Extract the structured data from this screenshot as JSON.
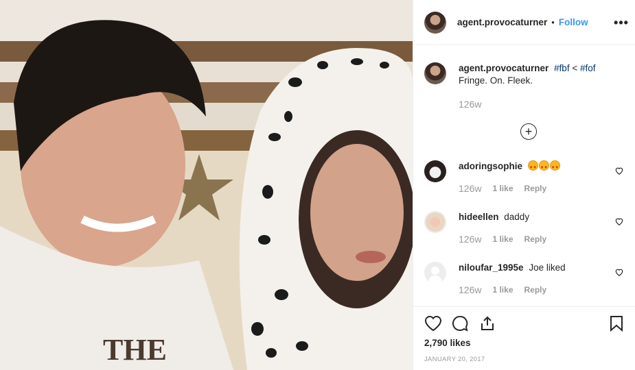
{
  "post": {
    "author": "agent.provocaturner",
    "follow_label": "Follow",
    "more_label": "•••",
    "caption": {
      "username": "agent.provocaturner",
      "hashtag1": "#fbf",
      "separator": "<",
      "hashtag2": "#fof",
      "text": "Fringe. On. Fleek.",
      "time": "126w"
    },
    "load_more_label": "+",
    "comments": [
      {
        "username": "adoringsophie",
        "text": "",
        "emoji": "heart-eyes x3",
        "time": "126w",
        "likes": "1 like",
        "reply": "Reply"
      },
      {
        "username": "hideellen",
        "text": "daddy",
        "time": "126w",
        "likes": "1 like",
        "reply": "Reply"
      },
      {
        "username": "niloufar_1995e",
        "text": "Joe liked",
        "time": "126w",
        "likes": "1 like",
        "reply": "Reply"
      }
    ],
    "like_count": "2,790 likes",
    "date": "JANUARY 20, 2017"
  },
  "colors": {
    "link": "#3897f0",
    "hashtag": "#003569",
    "muted": "#999999"
  }
}
